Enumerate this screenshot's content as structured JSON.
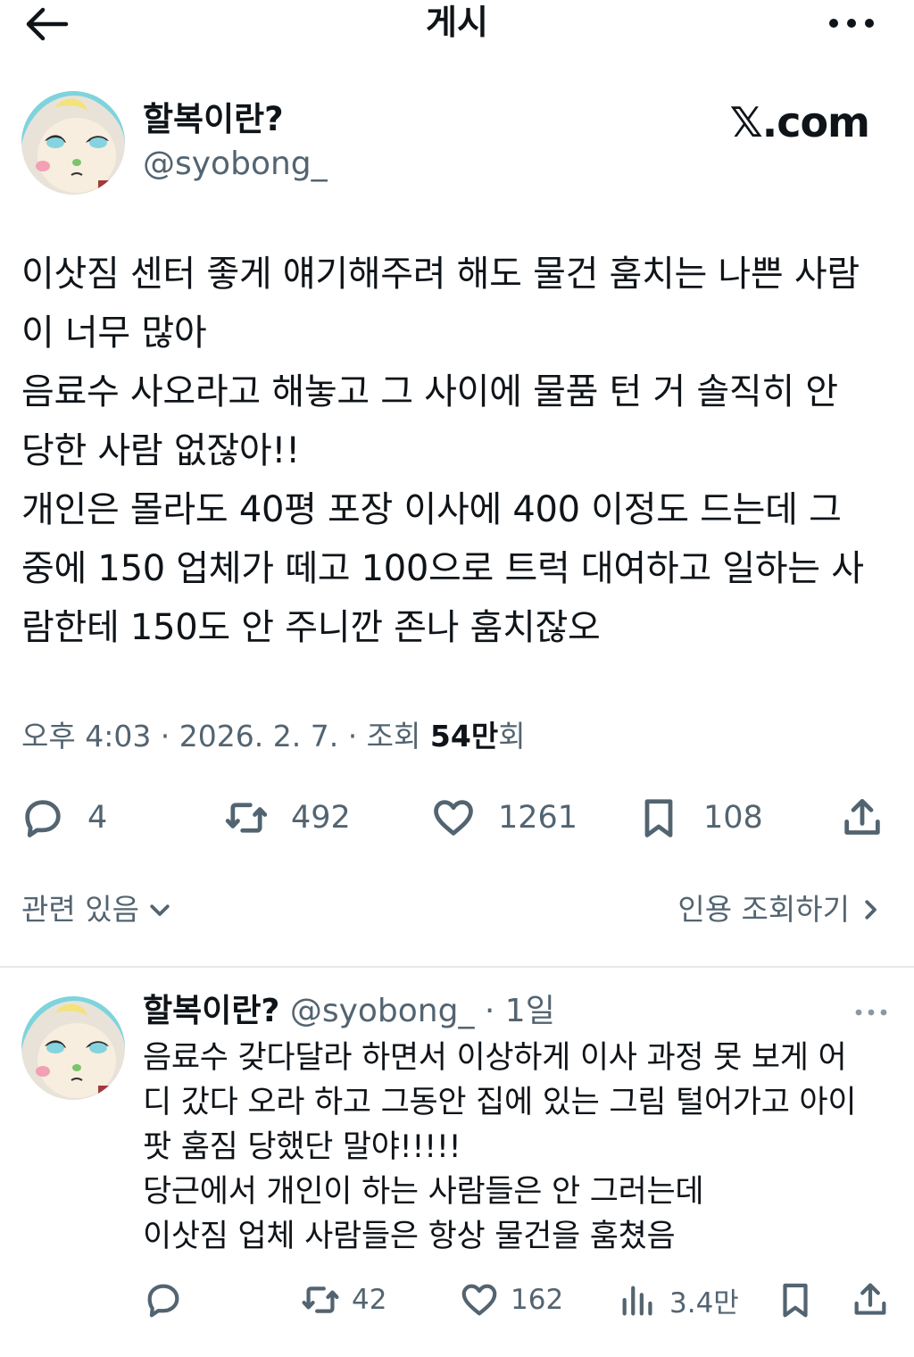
{
  "header": {
    "title": "게시",
    "back_icon": "arrow-left-icon",
    "more_icon": "more-horizontal-icon"
  },
  "post": {
    "author_name": "할복이란?",
    "author_handle": "@syobong_",
    "watermark": "𝕏.com",
    "text": "이삿짐 센터 좋게 얘기해주려 해도 물건 훔치는 나쁜 사람\n이 너무 많아\n음료수 사오라고 해놓고 그 사이에 물품 턴 거 솔직히 안\n당한 사람 없잖아!!\n개인은 몰라도 40평 포장 이사에 400 이정도 드는데 그\n중에 150 업체가 떼고 100으로 트럭 대여하고 일하는 사\n람한테 150도 안 주니깐 존나 훔치잖오",
    "time": "오후 4:03 · 2026. 2. 7. · 조회 ",
    "views": "54만",
    "views_suffix": "회",
    "stats": {
      "replies": "4",
      "reposts": "492",
      "likes": "1261",
      "bookmarks": "108"
    },
    "related_label": "관련 있음",
    "quotes_label": "인용 조회하기"
  },
  "reply": {
    "author_name": "할복이란?",
    "author_handle": "@syobong_",
    "time": " · 1일",
    "text": "음료수 갖다달라 하면서 이상하게 이사 과정 못 보게 어\n디 갔다 오라 하고 그동안 집에 있는 그림 털어가고 아이\n팟 훔짐 당했단 말야!!!!!\n당근에서 개인이 하는 사람들은 안 그러는데\n이삿짐 업체 사람들은 항상 물건을 훔쳤음",
    "stats": {
      "reposts": "42",
      "likes": "162",
      "views": "3.4만"
    }
  },
  "colors": {
    "text": "#0f1419",
    "secondary": "#536471",
    "divider": "#e6e9ec"
  }
}
